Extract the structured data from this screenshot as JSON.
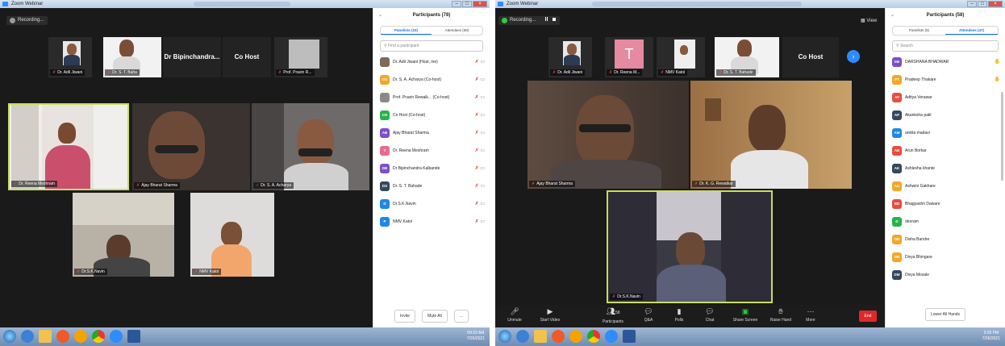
{
  "w1": {
    "title": "Zoom Webinar",
    "recording": "Recording...",
    "top_strip": [
      {
        "name": "Dr. Adil Jiwani"
      },
      {
        "name": "Dr. S. T. Baha"
      },
      {
        "name": "Dr Bipinchandra..."
      },
      {
        "name": "Co Host"
      },
      {
        "name": "Prof. Pravin R..."
      }
    ],
    "tiles": [
      {
        "name": "Dr. Reena Meshram"
      },
      {
        "name": "Ajay Bharat Sharma"
      },
      {
        "name": "Dr. S. A. Acharya"
      },
      {
        "name": "Dr.S.K.Navin"
      },
      {
        "name": "NMV Katol"
      }
    ],
    "panel": {
      "title": "Participants (78)",
      "tab_panelists": "Panelists (10)",
      "tab_attendees": "Attendees (68)",
      "search_placeholder": "Find a participant",
      "items": [
        {
          "initials": "",
          "name": "Dr. Adil Jiwani (Host, me)",
          "color": "#7d6a5a"
        },
        {
          "initials": "DS",
          "name": "Dr. S. A. Acharya (Co-host)",
          "color": "#f5a623"
        },
        {
          "initials": "",
          "name": "Prof. Pravin Rewalk... (Co-host)",
          "color": "#8a8a8a"
        },
        {
          "initials": "CH",
          "name": "Co Host (Co-host)",
          "color": "#27b34b"
        },
        {
          "initials": "AB",
          "name": "Ajay Bharat Sharma",
          "color": "#7b4fc9"
        },
        {
          "initials": "T",
          "name": "Dr. Reena Meshram",
          "color": "#e86a8f"
        },
        {
          "initials": "DB",
          "name": "Dr Bipinchandra Kalbande",
          "color": "#7b4fc9"
        },
        {
          "initials": "DS",
          "name": "Dr. S. T. Bahade",
          "color": "#34495e"
        },
        {
          "initials": "D",
          "name": "Dr.S.K.Navin",
          "color": "#1e88e5"
        },
        {
          "initials": "P",
          "name": "NMV Katol",
          "color": "#1e88e5"
        }
      ],
      "invite": "Invite",
      "mute_all": "Mute All",
      "more": "..."
    },
    "clock": {
      "time": "09:23 AM",
      "date": "7/26/2021"
    }
  },
  "w2": {
    "title": "Zoom Webinar",
    "recording": "Recording...",
    "view": "View",
    "top_strip": [
      {
        "name": "Dr. Adil Jiwani"
      },
      {
        "name": "Dr. Reena M..."
      },
      {
        "name": "NMV Katol"
      },
      {
        "name": "Dr. S. T. Bahade"
      },
      {
        "name": "Co Host"
      }
    ],
    "tiles": [
      {
        "name": "Ajay Bharat Sharma"
      },
      {
        "name": "Dr. K. G. Rewatkar"
      },
      {
        "name": "Dr.S.K.Navin"
      }
    ],
    "panel": {
      "title": "Participants (58)",
      "tab_panelists": "Panelists (9)",
      "tab_attendees": "Attendees (47)",
      "search_placeholder": "Search",
      "items": [
        {
          "initials": "DB",
          "name": "DARSHANA BHADWAR",
          "color": "#7b4fc9",
          "hand": true
        },
        {
          "initials": "PT",
          "name": "Pradeep Thakare",
          "color": "#f5a623",
          "hand": true
        },
        {
          "initials": "AV",
          "name": "Aditya Verawar",
          "color": "#e74c3c"
        },
        {
          "initials": "AP",
          "name": "Akanksha patil",
          "color": "#34495e"
        },
        {
          "initials": "AM",
          "name": "ankita madavi",
          "color": "#1e88e5"
        },
        {
          "initials": "AB",
          "name": "Arun Borkar",
          "color": "#e74c3c"
        },
        {
          "initials": "AK",
          "name": "Ashlesha khante",
          "color": "#34495e"
        },
        {
          "initials": "AG",
          "name": "Ashwini Gakhare",
          "color": "#f5a623"
        },
        {
          "initials": "BD",
          "name": "Bhagyashri Daware",
          "color": "#e74c3c"
        },
        {
          "initials": "D",
          "name": "deoram",
          "color": "#27b34b"
        },
        {
          "initials": "DB",
          "name": "Disha Bandre",
          "color": "#f5a623"
        },
        {
          "initials": "DB",
          "name": "Divya Bhingare",
          "color": "#f5a623"
        },
        {
          "initials": "DM",
          "name": "Divya Mosale",
          "color": "#34495e"
        }
      ],
      "lower_hands": "Lower All Hands"
    },
    "toolbar": {
      "unmute": "Unmute",
      "start_video": "Start Video",
      "participant_count": "58",
      "participants": "Participants",
      "qa": "Q&A",
      "polls": "Polls",
      "chat": "Chat",
      "share_screen": "Share Screen",
      "raise_hand": "Raise Hand",
      "more": "More",
      "end": "End"
    },
    "clock": {
      "time": "3:03 PM",
      "date": "7/26/2021"
    }
  }
}
